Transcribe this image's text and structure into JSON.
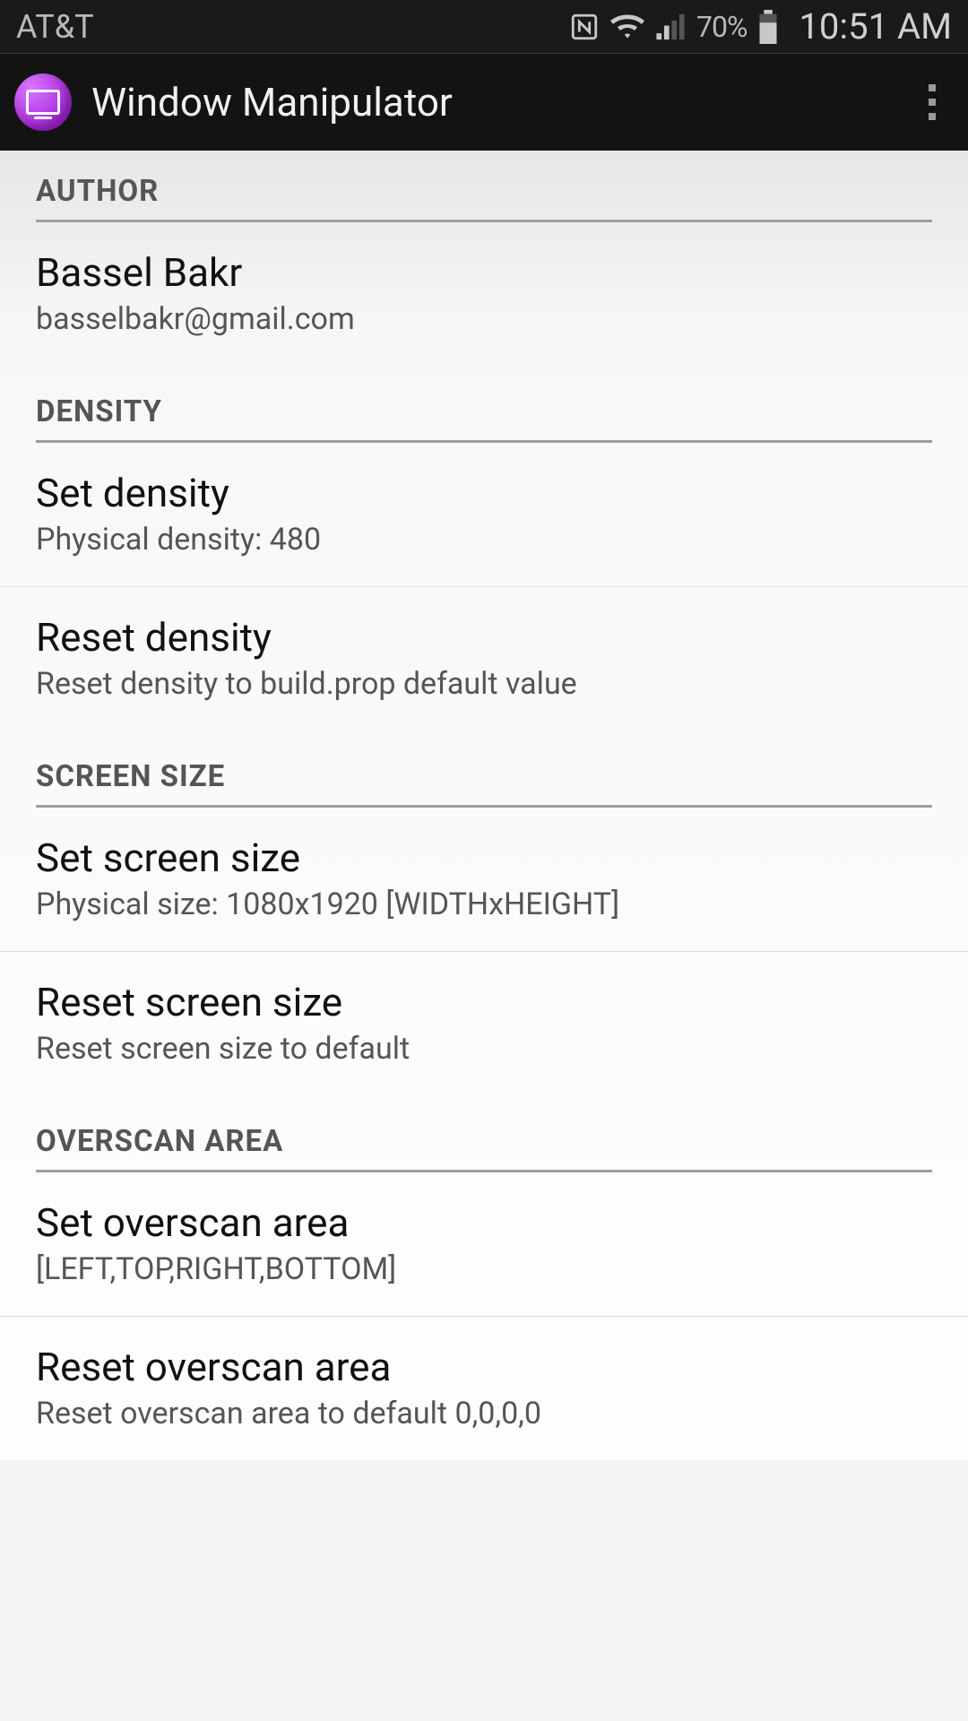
{
  "status": {
    "carrier": "AT&T",
    "battery_pct": "70%",
    "time": "10:51 AM"
  },
  "actionbar": {
    "title": "Window Manipulator"
  },
  "sections": {
    "author": {
      "header": "AUTHOR",
      "name": "Bassel Bakr",
      "email": "basselbakr@gmail.com"
    },
    "density": {
      "header": "DENSITY",
      "set_title": "Set density",
      "set_summary": "Physical density: 480",
      "reset_title": "Reset density",
      "reset_summary": "Reset density to build.prop default value"
    },
    "screen_size": {
      "header": "SCREEN SIZE",
      "set_title": "Set screen size",
      "set_summary": "Physical size: 1080x1920 [WIDTHxHEIGHT]",
      "reset_title": "Reset screen size",
      "reset_summary": "Reset screen size to default"
    },
    "overscan": {
      "header": "OVERSCAN AREA",
      "set_title": "Set overscan area",
      "set_summary": "[LEFT,TOP,RIGHT,BOTTOM]",
      "reset_title": "Reset overscan area",
      "reset_summary": "Reset overscan area to default 0,0,0,0"
    }
  }
}
